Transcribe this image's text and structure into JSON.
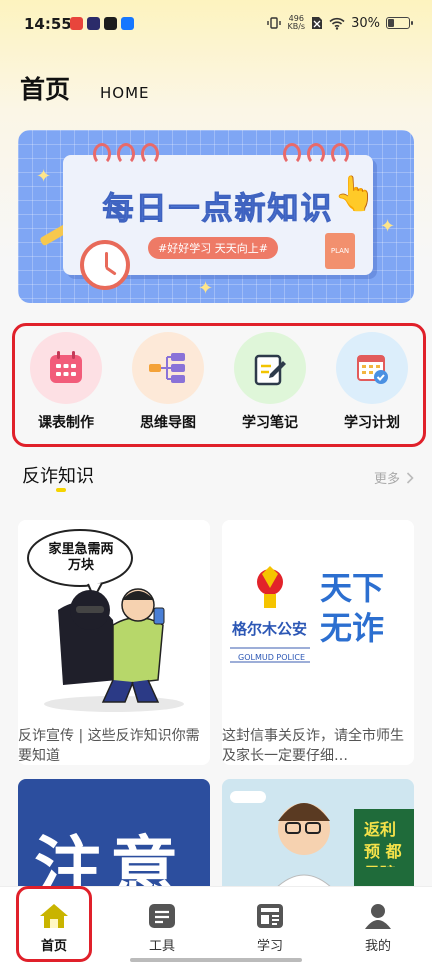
{
  "status_bar": {
    "time": "14:55",
    "net_speed_value": "496",
    "net_speed_unit": "KB/s",
    "battery_percent": "30%",
    "battery_level": 0.3
  },
  "header": {
    "title": "首页",
    "subtitle": "HOME"
  },
  "banner": {
    "headline": "每日一点新知识",
    "tag": "#好好学习 天天向上#",
    "sticker": "PLAN"
  },
  "quick_actions": [
    {
      "label": "课表制作",
      "icon": "calendar-icon"
    },
    {
      "label": "思维导图",
      "icon": "mindmap-icon"
    },
    {
      "label": "学习笔记",
      "icon": "note-icon"
    },
    {
      "label": "学习计划",
      "icon": "plan-icon"
    }
  ],
  "section": {
    "title": "反诈知识",
    "more": "更多"
  },
  "articles": [
    {
      "caption": "反诈宣传 | 这些反诈知识你需要知道",
      "image_text": "家里急需两万块"
    },
    {
      "caption": "这封信事关反诈，请全市师生及家长一定要仔细…",
      "image_text_left": "格尔木公安",
      "image_text_right": "天下无诈",
      "image_text_small": "GOLMUD POLICE"
    }
  ],
  "articles_row2": [
    {
      "image_text": "注意"
    },
    {
      "image_text": "返利预 都是骗"
    }
  ],
  "tabbar": [
    {
      "label": "首页",
      "icon": "home-icon",
      "active": true
    },
    {
      "label": "工具",
      "icon": "tools-icon",
      "active": false
    },
    {
      "label": "学习",
      "icon": "study-icon",
      "active": false
    },
    {
      "label": "我的",
      "icon": "profile-icon",
      "active": false
    }
  ],
  "colors": {
    "highlight_border": "#e0202a",
    "accent_yellow": "#f5d400",
    "tab_active": "#c9b400"
  }
}
